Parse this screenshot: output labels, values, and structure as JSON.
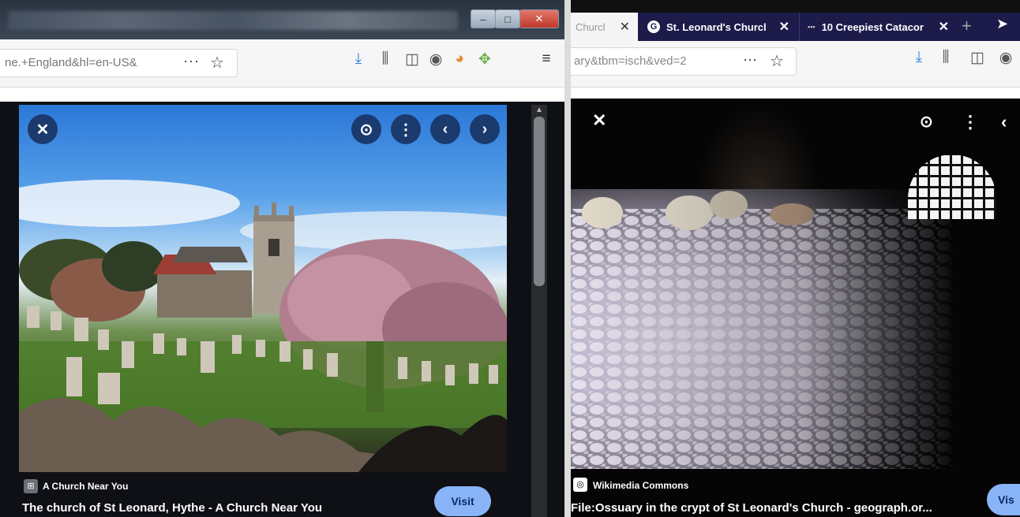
{
  "left": {
    "url_fragment": "ne.+England&hl=en-US&",
    "toolbar_dots": "···",
    "viewer": {
      "source_name": "A Church Near You",
      "caption": "The church of St Leonard, Hythe - A Church Near You",
      "visit_label": "Visit"
    }
  },
  "right": {
    "tabs": [
      {
        "label": "Churcl",
        "close": "✕"
      },
      {
        "label": "St. Leonard's Churcl",
        "close": "✕"
      },
      {
        "label": "10 Creepiest Catacor",
        "close": "✕"
      }
    ],
    "url_fragment": "ary&tbm=isch&ved=2",
    "toolbar_dots": "···",
    "viewer": {
      "source_name": "Wikimedia Commons",
      "caption": "File:Ossuary in the crypt of St Leonard's Church - geograph.or...",
      "visit_label": "Vis"
    }
  },
  "colors": {
    "overlay_button": "#1b3a6e",
    "visit_button": "#8ab4f8",
    "tabstrip": "#1c1b4a"
  }
}
